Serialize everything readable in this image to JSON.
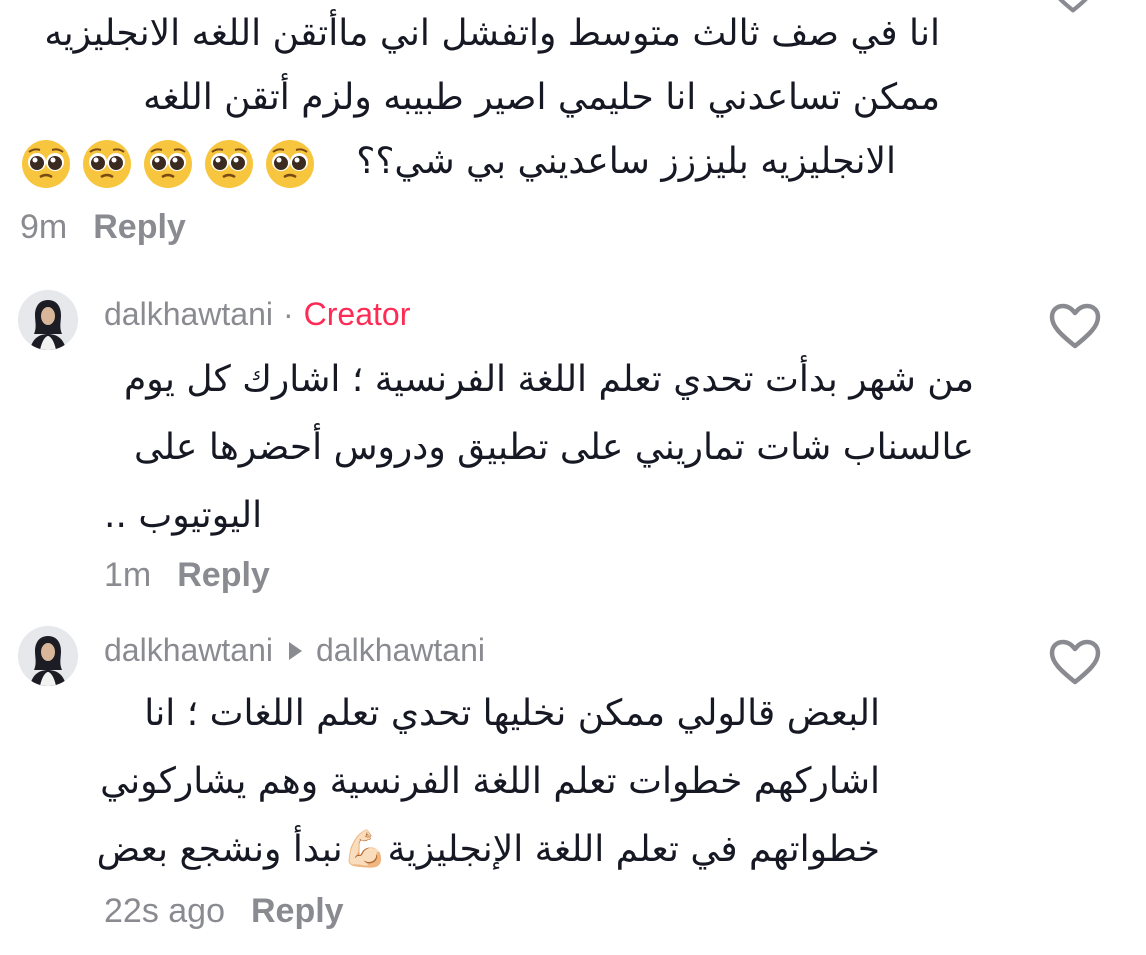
{
  "comments": [
    {
      "lines": [
        "انا في صف ثالث متوسط واتفشل اني ماأتقن اللغه الانجليزيه",
        "ممكن تساعدني انا حليمي اصير طبيبه ولزم أتقن اللغه",
        "الانجليزيه بليززز ساعديني بي شي؟؟"
      ],
      "emoji_count": 5,
      "time": "9m",
      "reply_label": "Reply"
    },
    {
      "username": "dalkhawtani",
      "separator": "·",
      "badge": "Creator",
      "lines": [
        "من شهر بدأت تحدي تعلم اللغة الفرنسية ؛ اشارك كل يوم",
        "عالسناب شات تماريني على تطبيق ودروس أحضرها على",
        "اليوتيوب .."
      ],
      "time": "1m",
      "reply_label": "Reply"
    },
    {
      "username": "dalkhawtani",
      "reply_to": "dalkhawtani",
      "lines": [
        "البعض قالولي ممكن نخليها تحدي تعلم اللغات ؛ انا",
        "اشاركهم خطوات تعلم اللغة الفرنسية وهم يشاركوني",
        "خطواتهم في تعلم اللغة الإنجليزية💪🏻نبدأ ونشجع بعض"
      ],
      "time": "22s ago",
      "reply_label": "Reply"
    }
  ],
  "colors": {
    "text": "#161823",
    "muted": "#8a8b91",
    "creator": "#fe2c55"
  },
  "icons": [
    "heart-outline-icon",
    "pleading-face-emoji",
    "avatar"
  ]
}
